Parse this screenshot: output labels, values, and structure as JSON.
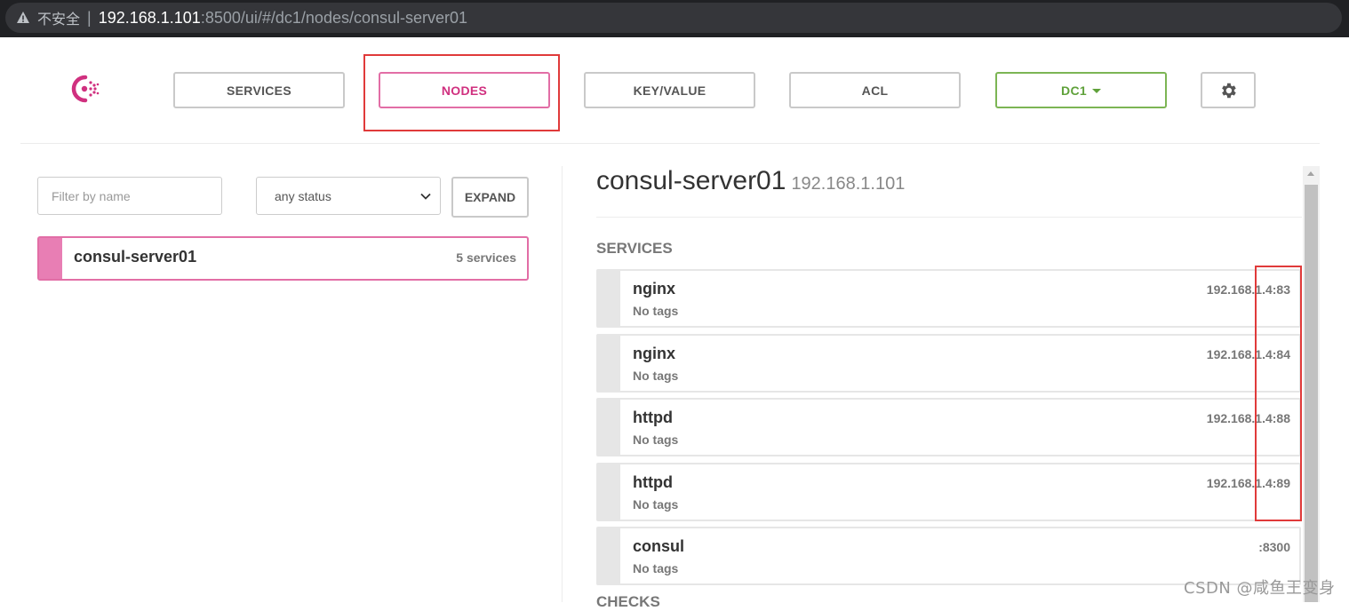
{
  "browser": {
    "security_label": "不安全",
    "separator": "|",
    "url_host": "192.168.1.101",
    "url_rest": ":8500/ui/#/dc1/nodes/consul-server01"
  },
  "nav": {
    "services_label": "SERVICES",
    "nodes_label": "NODES",
    "keyvalue_label": "KEY/VALUE",
    "acl_label": "ACL",
    "dc_label": "DC1",
    "active": "NODES",
    "settings_icon": "gear-icon",
    "brand_color": "#e26ea6",
    "dc_color": "#7cb554"
  },
  "filter": {
    "name_placeholder": "Filter by name",
    "status_value": "any status",
    "expand_label": "EXPAND"
  },
  "nodes": [
    {
      "name": "consul-server01",
      "services_count": "5 services"
    }
  ],
  "detail": {
    "node_name": "consul-server01",
    "node_ip": "192.168.1.101",
    "services_heading": "SERVICES",
    "checks_heading": "CHECKS",
    "services": [
      {
        "name": "nginx",
        "tags": "No tags",
        "address": "192.168.1.4:83"
      },
      {
        "name": "nginx",
        "tags": "No tags",
        "address": "192.168.1.4:84"
      },
      {
        "name": "httpd",
        "tags": "No tags",
        "address": "192.168.1.4:88"
      },
      {
        "name": "httpd",
        "tags": "No tags",
        "address": "192.168.1.4:89"
      },
      {
        "name": "consul",
        "tags": "No tags",
        "address": ":8300"
      }
    ]
  },
  "watermark": "CSDN @咸鱼王变身"
}
